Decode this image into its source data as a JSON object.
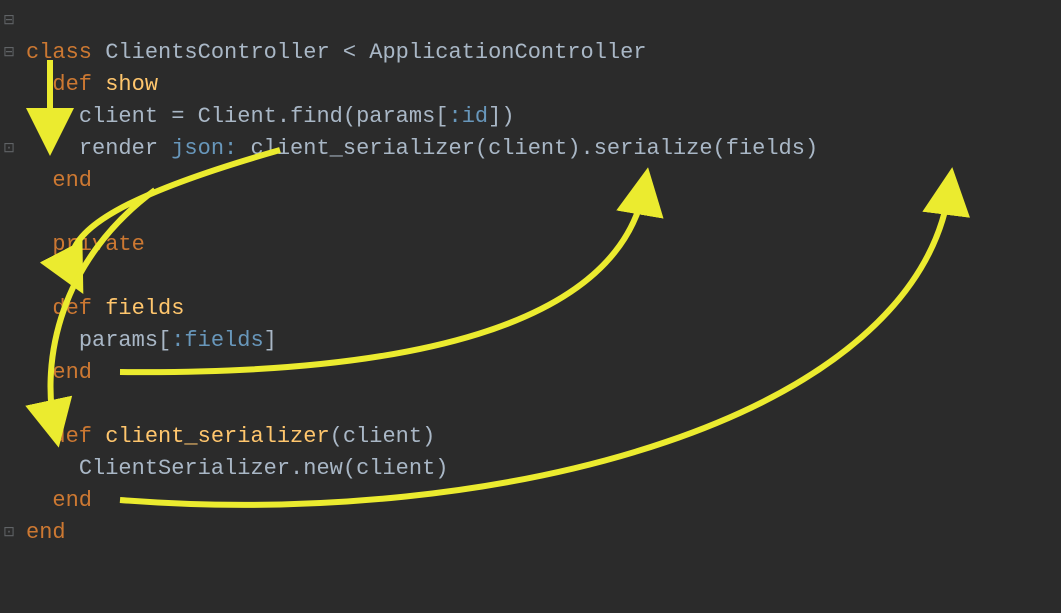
{
  "code": {
    "line1": {
      "class_kw": "class",
      "class_name": "ClientsController",
      "lt": "<",
      "parent": "ApplicationController"
    },
    "line2": {
      "def_kw": "def",
      "method": "show"
    },
    "line3": {
      "var": "client",
      "eq": "=",
      "const": "Client",
      "dot": ".",
      "find": "find",
      "open": "(",
      "params": "params",
      "bopen": "[",
      "sym": ":id",
      "bclose": "]",
      "close": ")"
    },
    "line4": {
      "render": "render",
      "jsonlabel": "json:",
      "cs": "client_serializer",
      "open": "(",
      "arg": "client",
      "close": ")",
      "dot": ".",
      "serialize": "serialize",
      "open2": "(",
      "fields": "fields",
      "close2": ")"
    },
    "line5": {
      "end": "end"
    },
    "line7": {
      "private": "private"
    },
    "line9": {
      "def_kw": "def",
      "method": "fields"
    },
    "line10": {
      "params": "params",
      "bopen": "[",
      "sym": ":fields",
      "bclose": "]"
    },
    "line11": {
      "end": "end"
    },
    "line13": {
      "def_kw": "def",
      "method": "client_serializer",
      "open": "(",
      "arg": "client",
      "close": ")"
    },
    "line14": {
      "const": "ClientSerializer",
      "dot": ".",
      "new": "new",
      "open": "(",
      "arg": "client",
      "close": ")"
    },
    "line15": {
      "end": "end"
    },
    "line16": {
      "end": "end"
    }
  },
  "folds": {
    "minus1": "⊟",
    "minus2": "⊟",
    "up1": "⊡",
    "up2": "⊡"
  }
}
